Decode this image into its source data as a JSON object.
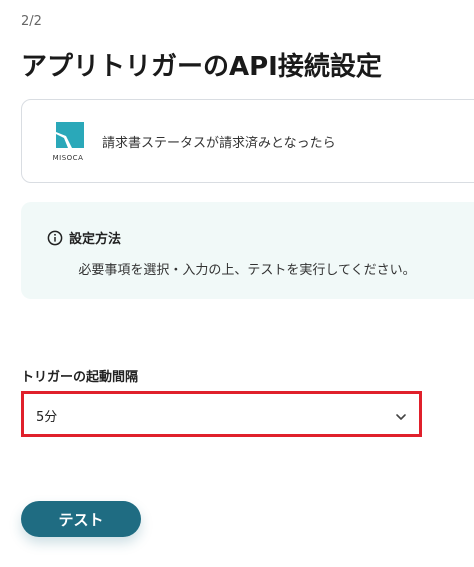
{
  "header": {
    "step": "2/2",
    "title": "アプリトリガーのAPI接続設定"
  },
  "app_card": {
    "logo_text": "MISOCA",
    "logo_color": "#2aa8b9",
    "trigger_text": "請求書ステータスが請求済みとなったら"
  },
  "info": {
    "icon": "info-circle-icon",
    "title": "設定方法",
    "description": "必要事項を選択・入力の上、テストを実行してください。",
    "background_color": "#f1f9f8"
  },
  "form": {
    "interval_label": "トリガーの起動間隔",
    "interval_value": "5分",
    "highlight_color": "#e0202b"
  },
  "actions": {
    "test_label": "テスト",
    "button_color": "#1f6c82"
  }
}
